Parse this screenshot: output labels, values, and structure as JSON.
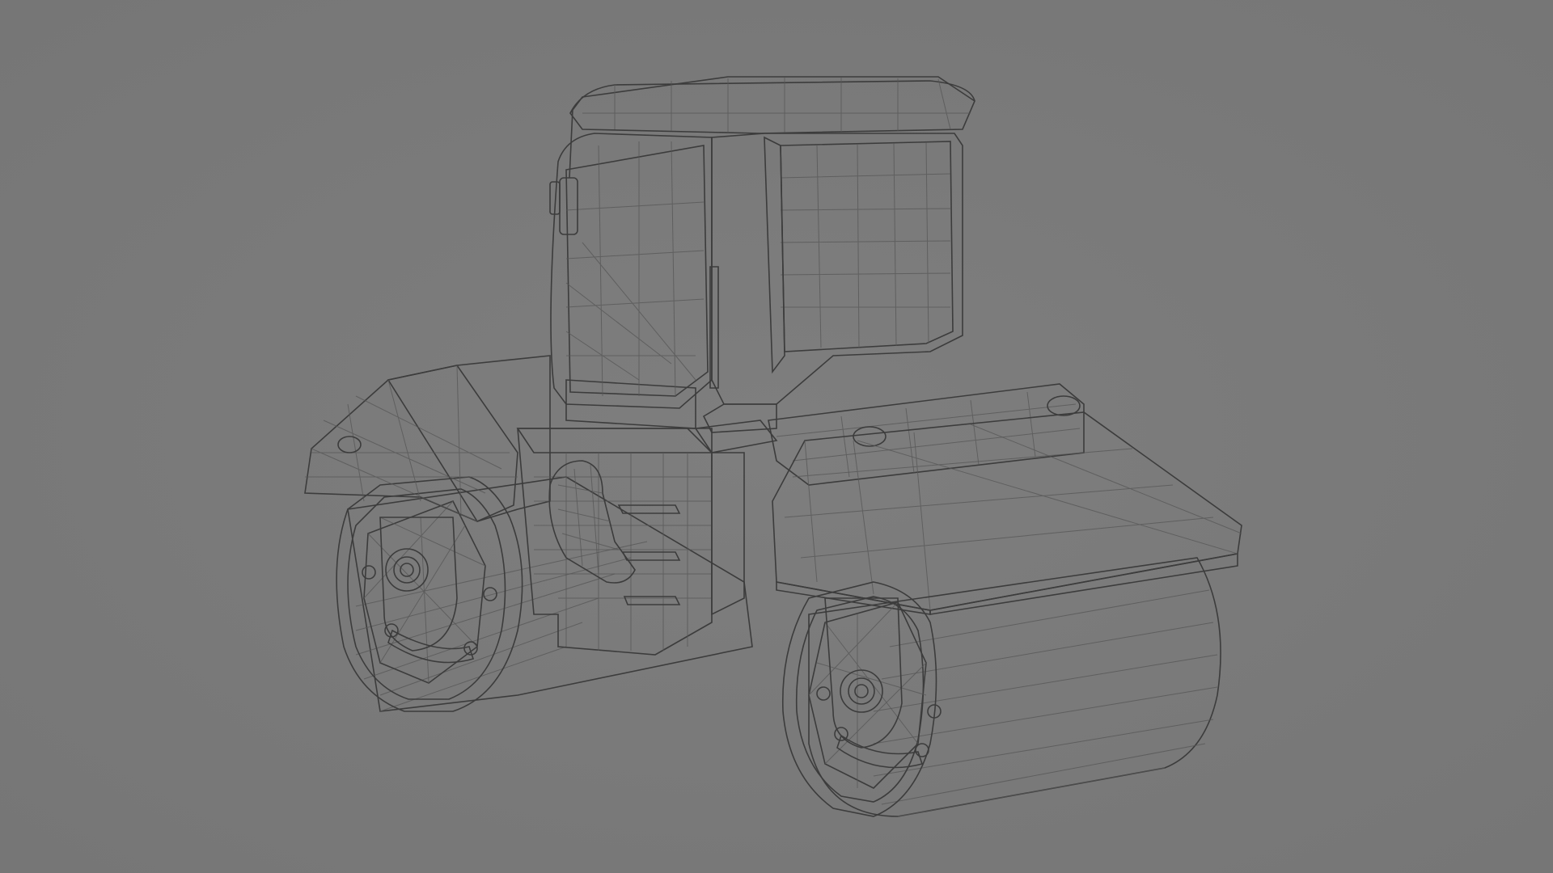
{
  "scene": {
    "subject": "road-roller-wireframe-model",
    "background_color": "#7a7a7a",
    "surface_light": "#e4e4e4",
    "surface_mid": "#cfcfcf",
    "surface_dark": "#a9a9a9",
    "wire_color": "#555555"
  }
}
